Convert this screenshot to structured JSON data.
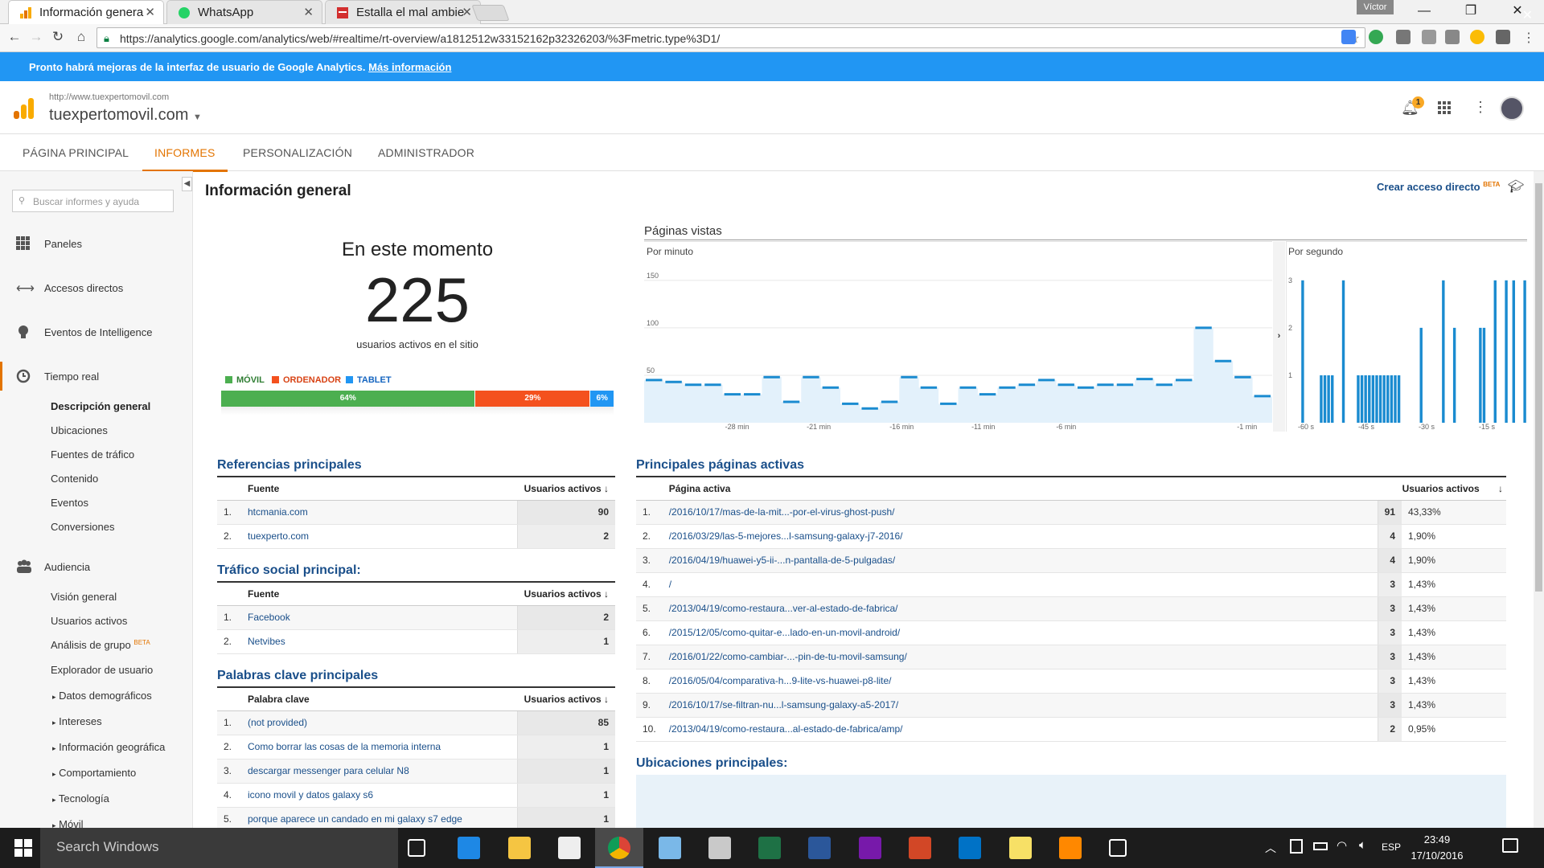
{
  "browser": {
    "tabs": [
      {
        "title": "Información genera",
        "icon": "google-analytics-icon"
      },
      {
        "title": "WhatsApp",
        "icon": "whatsapp-icon"
      },
      {
        "title": "Estalla el mal ambie",
        "icon": "news-icon"
      }
    ],
    "user": "Víctor",
    "url": "https://analytics.google.com/analytics/web/#realtime/rt-overview/a1812512w33152162p32326203/%3Fmetric.type%3D1/"
  },
  "banner": {
    "text": "Pronto habrá mejoras de la interfaz de usuario de Google Analytics.",
    "link": "Más información",
    "color": "#2196f3"
  },
  "header": {
    "site_url": "http://www.tuexpertomovil.com",
    "site_name": "tuexpertomovil.com",
    "notifications": "1"
  },
  "nav": {
    "tabs": [
      "PÁGINA PRINCIPAL",
      "INFORMES",
      "PERSONALIZACIÓN",
      "ADMINISTRADOR"
    ],
    "active": "INFORMES",
    "accent": "#e37400"
  },
  "sidebar": {
    "search_placeholder": "Buscar informes y ayuda",
    "items": [
      {
        "label": "Paneles",
        "icon": "grid-icon"
      },
      {
        "label": "Accesos directos",
        "icon": "arrows-icon"
      },
      {
        "label": "Eventos de Intelligence",
        "icon": "lightbulb-icon"
      },
      {
        "label": "Tiempo real",
        "icon": "clock-icon"
      }
    ],
    "realtime_sub": [
      "Descripción general",
      "Ubicaciones",
      "Fuentes de tráfico",
      "Contenido",
      "Eventos",
      "Conversiones"
    ],
    "audience": {
      "label": "Audiencia",
      "icon": "people-icon"
    },
    "audience_sub": [
      "Visión general",
      "Usuarios activos",
      "Análisis de grupo",
      "Explorador de usuario"
    ],
    "beta": "BETA",
    "audience_groups": [
      "Datos demográficos",
      "Intereses",
      "Información geográfica",
      "Comportamiento",
      "Tecnología",
      "Móvil"
    ]
  },
  "page": {
    "title": "Información general",
    "shortcut": "Crear acceso directo",
    "shortcut_beta": "BETA"
  },
  "right_now": {
    "title": "En este momento",
    "count": "225",
    "subtitle": "usuarios activos en el sitio",
    "devices": [
      {
        "name": "MÓVIL",
        "percent": 64,
        "label": "64%",
        "color": "#4caf50"
      },
      {
        "name": "ORDENADOR",
        "percent": 29,
        "label": "29%",
        "color": "#f4511e"
      },
      {
        "name": "TABLET",
        "percent": 6,
        "label": "6%",
        "color": "#2196f3"
      }
    ]
  },
  "chart_data": [
    {
      "type": "area",
      "title": "Páginas vistas",
      "subtitle": "Por minuto",
      "yticks": [
        "150",
        "100",
        "50"
      ],
      "ylim": [
        0,
        160
      ],
      "xticks": [
        "-28 min",
        "-21 min",
        "-16 min",
        "-11 min",
        "-6 min",
        "-1 min"
      ],
      "values": [
        45,
        43,
        40,
        40,
        30,
        30,
        48,
        22,
        48,
        37,
        20,
        15,
        22,
        48,
        37,
        20,
        37,
        30,
        37,
        40,
        45,
        40,
        37,
        40,
        40,
        46,
        40,
        45,
        100,
        65,
        48,
        28
      ]
    },
    {
      "type": "bar",
      "title": "",
      "subtitle": "Por segundo",
      "yticks": [
        "3",
        "2",
        "1"
      ],
      "ylim": [
        0,
        3.2
      ],
      "xticks": [
        "-60 s",
        "-45 s",
        "-30 s",
        "-15 s"
      ],
      "values": [
        0,
        0,
        3,
        0,
        0,
        0,
        0,
        1,
        1,
        1,
        1,
        0,
        0,
        3,
        0,
        0,
        0,
        1,
        1,
        1,
        1,
        1,
        1,
        1,
        1,
        1,
        1,
        1,
        1,
        0,
        0,
        0,
        0,
        0,
        2,
        0,
        0,
        0,
        0,
        0,
        3,
        0,
        0,
        2,
        0,
        0,
        0,
        0,
        0,
        0,
        2,
        2,
        0,
        0,
        3,
        0,
        0,
        3,
        0,
        3,
        0,
        0,
        3
      ]
    }
  ],
  "referrals": {
    "title": "Referencias principales",
    "col_source": "Fuente",
    "col_users": "Usuarios activos",
    "rows": [
      {
        "i": "1.",
        "name": "htcmania.com",
        "v": "90"
      },
      {
        "i": "2.",
        "name": "tuexperto.com",
        "v": "2"
      }
    ]
  },
  "social": {
    "title": "Tráfico social principal:",
    "col_source": "Fuente",
    "col_users": "Usuarios activos",
    "rows": [
      {
        "i": "1.",
        "name": "Facebook",
        "v": "2"
      },
      {
        "i": "2.",
        "name": "Netvibes",
        "v": "1"
      }
    ]
  },
  "keywords": {
    "title": "Palabras clave principales",
    "col_key": "Palabra clave",
    "col_users": "Usuarios activos",
    "rows": [
      {
        "i": "1.",
        "name": "(not provided)",
        "v": "85"
      },
      {
        "i": "2.",
        "name": "Como borrar las cosas de la memoria interna",
        "v": "1"
      },
      {
        "i": "3.",
        "name": "descargar messenger para celular N8",
        "v": "1"
      },
      {
        "i": "4.",
        "name": "icono movil y datos galaxy s6",
        "v": "1"
      },
      {
        "i": "5.",
        "name": "porque aparece un candado en mi galaxy s7 edge",
        "v": "1"
      }
    ]
  },
  "pages": {
    "title": "Principales páginas activas",
    "col_page": "Página activa",
    "col_users": "Usuarios activos",
    "rows": [
      {
        "i": "1.",
        "name": "/2016/10/17/mas-de-la-mit...-por-el-virus-ghost-push/",
        "v": "91",
        "p": "43,33%"
      },
      {
        "i": "2.",
        "name": "/2016/03/29/las-5-mejores...l-samsung-galaxy-j7-2016/",
        "v": "4",
        "p": "1,90%"
      },
      {
        "i": "3.",
        "name": "/2016/04/19/huawei-y5-ii-...n-pantalla-de-5-pulgadas/",
        "v": "4",
        "p": "1,90%"
      },
      {
        "i": "4.",
        "name": "/",
        "v": "3",
        "p": "1,43%"
      },
      {
        "i": "5.",
        "name": "/2013/04/19/como-restaura...ver-al-estado-de-fabrica/",
        "v": "3",
        "p": "1,43%"
      },
      {
        "i": "6.",
        "name": "/2015/12/05/como-quitar-e...lado-en-un-movil-android/",
        "v": "3",
        "p": "1,43%"
      },
      {
        "i": "7.",
        "name": "/2016/01/22/como-cambiar-...-pin-de-tu-movil-samsung/",
        "v": "3",
        "p": "1,43%"
      },
      {
        "i": "8.",
        "name": "/2016/05/04/comparativa-h...9-lite-vs-huawei-p8-lite/",
        "v": "3",
        "p": "1,43%"
      },
      {
        "i": "9.",
        "name": "/2016/10/17/se-filtran-nu...l-samsung-galaxy-a5-2017/",
        "v": "3",
        "p": "1,43%"
      },
      {
        "i": "10.",
        "name": "/2013/04/19/como-restaura...al-estado-de-fabrica/amp/",
        "v": "2",
        "p": "0,95%"
      }
    ]
  },
  "locations": {
    "title": "Ubicaciones principales:"
  },
  "taskbar": {
    "search": "Search Windows",
    "lang": "ESP",
    "time": "23:49",
    "date": "17/10/2016",
    "apps": [
      "task-view-icon",
      "edge-icon",
      "explorer-icon",
      "store-icon",
      "chrome-icon",
      "paint-icon",
      "snipping-icon",
      "excel-icon",
      "word-icon",
      "onenote-icon",
      "powerpoint-icon",
      "outlook-icon",
      "sticky-notes-icon",
      "vlc-icon",
      "settings-icon"
    ]
  }
}
